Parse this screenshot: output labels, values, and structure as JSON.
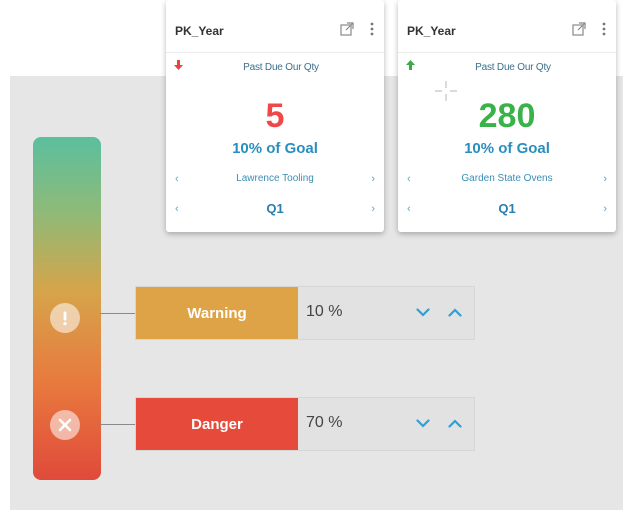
{
  "cards": [
    {
      "title": "PK_Year",
      "trend_icon": "arrow-down-icon",
      "trend_glyph": "🡇",
      "trend_color": "#e8463a",
      "metric": "Past Due Our Qty",
      "value": "5",
      "value_color": "#f04848",
      "goal": "10% of Goal",
      "nav_label": "Lawrence Tooling",
      "period": "Q1"
    },
    {
      "title": "PK_Year",
      "trend_icon": "arrow-up-icon",
      "trend_glyph": "🡅",
      "trend_color": "#3caa4a",
      "metric": "Past Due Our Qty",
      "value": "280",
      "value_color": "#3ab24a",
      "goal": "10% of Goal",
      "nav_label": "Garden State Ovens",
      "period": "Q1"
    }
  ],
  "thresholds": [
    {
      "label": "Warning",
      "value": "10 %",
      "color": "#dfa347",
      "icon": "exclamation-icon"
    },
    {
      "label": "Danger",
      "value": "70 %",
      "color": "#e64a3b",
      "icon": "x-circle-icon"
    }
  ],
  "colors": {
    "gauge_top": "#5bbf9e",
    "gauge_bottom": "#e04a3a",
    "chevron": "#2f9fd8"
  }
}
